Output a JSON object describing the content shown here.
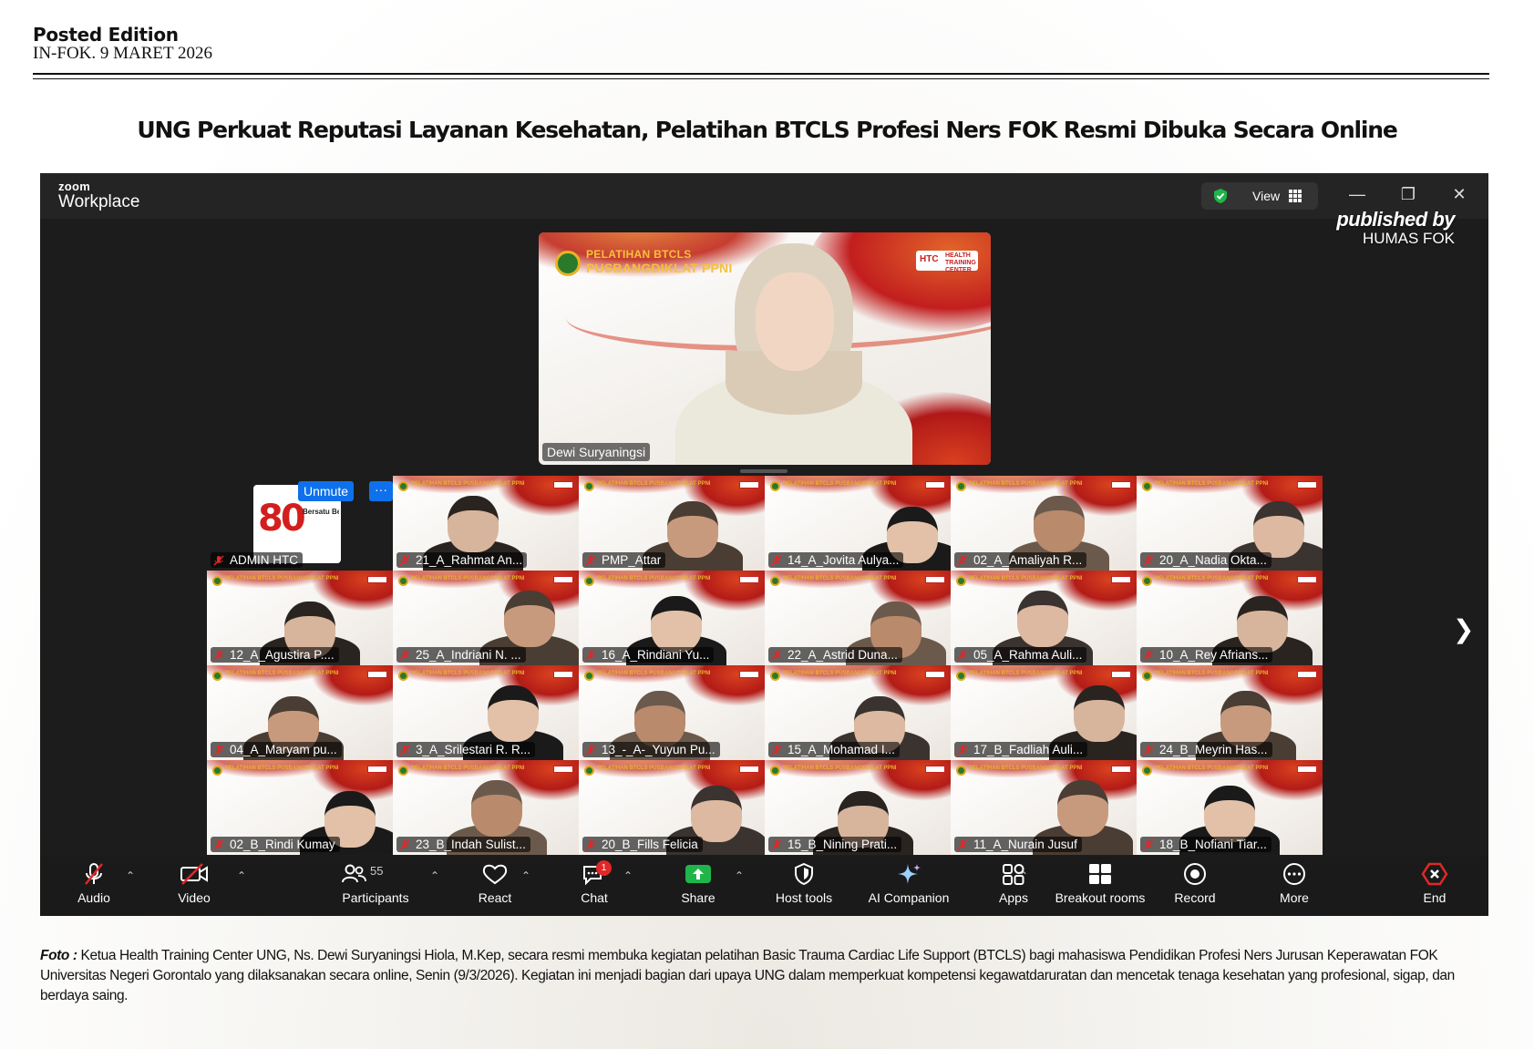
{
  "masthead": {
    "edition": "Posted Edition",
    "dateline": "IN-FOK. 9 MARET 2026"
  },
  "headline": "UNG Perkuat Reputasi Layanan Kesehatan, Pelatihan BTCLS Profesi Ners FOK Resmi Dibuka Secara Online",
  "zoom": {
    "brand_small": "zoom",
    "brand_big": "Workplace",
    "view_label": "View",
    "watermark_by": "published by",
    "watermark_org": "HUMAS FOK",
    "speaker": {
      "banner_line1": "PELATIHAN BTCLS",
      "banner_line2": "PUSBANGDIKLAT PPNI",
      "htc_logo": "HTC",
      "htc_text": "HEALTH TRAINING CENTER",
      "name": "Dewi Suryaningsi"
    },
    "admin_tile": {
      "name": "ADMIN HTC",
      "logo_number": "80",
      "logo_text": "Bersatu Berdaulat Rakyat Sejahtera Indonesia Maju",
      "unmute_label": "Unmute",
      "more_label": "···"
    },
    "tile_logo_text": "PELATIHAN BTCLS PUSBANGDIKLAT PPNI",
    "participants": [
      "21_A_Rahmat An...",
      "PMP_Attar",
      "14_A_Jovita Aulya...",
      "02_A_Amaliyah R...",
      "20_A_Nadia Okta...",
      "12_A_Agustira P....",
      "25_A_Indriani N. ...",
      "16_A_Rindiani Yu...",
      "22_A_Astrid Duna...",
      "05_A_Rahma Auli...",
      "10_A_Rey Afrians...",
      "04_A_Maryam pu...",
      "3_A_Srilestari R. R...",
      "13_-_A-_Yuyun Pu...",
      "15_A_Mohamad I...",
      "17_B_Fadliah Auli...",
      "24_B_Meyrin Has...",
      "02_B_Rindi Kumay",
      "23_B_Indah Sulist...",
      "20_B_Fills Felicia",
      "15_B_Nining Prati...",
      "11_A_Nurain Jusuf",
      "18_B_Nofiani Tiar..."
    ],
    "toolbar": {
      "audio": "Audio",
      "video": "Video",
      "participants": "Participants",
      "participants_count": "55",
      "react": "React",
      "chat": "Chat",
      "chat_badge": "1",
      "share": "Share",
      "host_tools": "Host tools",
      "ai_companion": "AI Companion",
      "apps": "Apps",
      "breakout_rooms": "Breakout rooms",
      "record": "Record",
      "more": "More",
      "end": "End"
    }
  },
  "caption": {
    "lead": "Foto :",
    "text": " Ketua Health Training Center UNG, Ns. Dewi Suryaningsi Hiola, M.Kep, secara resmi membuka kegiatan pelatihan Basic Trauma Cardiac Life Support (BTCLS) bagi mahasiswa Pendidikan Profesi Ners Jurusan Keperawatan FOK Universitas Negeri Gorontalo yang dilaksanakan secara online, Senin (9/3/2026). Kegiatan ini menjadi bagian dari upaya UNG dalam memperkuat kompetensi kegawatdaruratan dan mencetak tenaga kesehatan yang profesional, sigap, dan berdaya saing."
  },
  "colors": {
    "zoom_bg": "#1c1c1c",
    "zoom_blue": "#0e71eb",
    "share_green": "#1fb54a",
    "end_red": "#e02828",
    "banner_red": "#c21e1e",
    "banner_gold": "#f4c23a"
  }
}
